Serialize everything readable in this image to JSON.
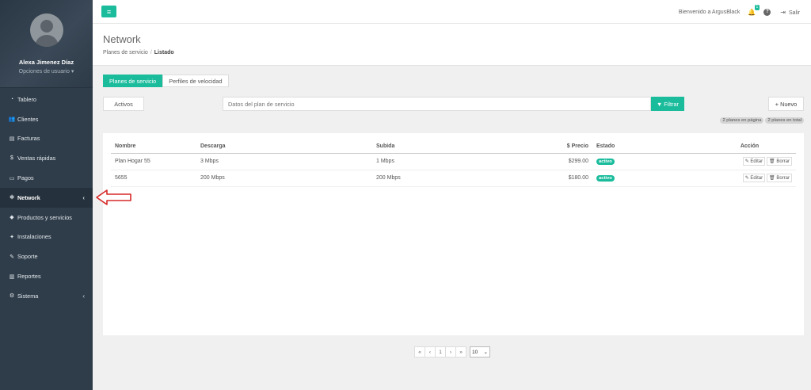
{
  "user": {
    "name": "Alexa Jimenez Díaz",
    "options": "Opciones de usuario"
  },
  "nav": [
    {
      "label": "Tablero",
      "icon": "dashboard-icon",
      "glyph": "◔"
    },
    {
      "label": "Clientes",
      "icon": "users-icon",
      "glyph": "👥"
    },
    {
      "label": "Facturas",
      "icon": "file-icon",
      "glyph": "▤"
    },
    {
      "label": "Ventas rápidas",
      "icon": "dollar-icon",
      "glyph": "$"
    },
    {
      "label": "Pagos",
      "icon": "money-icon",
      "glyph": "▭"
    },
    {
      "label": "Network",
      "icon": "sitemap-icon",
      "glyph": "✲",
      "active": true,
      "chevron": "‹"
    },
    {
      "label": "Productos y servicios",
      "icon": "tag-icon",
      "glyph": "◆"
    },
    {
      "label": "Instalaciones",
      "icon": "wrench-icon",
      "glyph": "✦"
    },
    {
      "label": "Soporte",
      "icon": "tool-icon",
      "glyph": "✎"
    },
    {
      "label": "Reportes",
      "icon": "book-icon",
      "glyph": "▥"
    },
    {
      "label": "Sistema",
      "icon": "cogs-icon",
      "glyph": "⚙",
      "chevron": "‹"
    }
  ],
  "topbar": {
    "welcome": "Bienvenido a ArgusBlack",
    "notifications": "1",
    "help": "?",
    "logout": "Salir"
  },
  "header": {
    "title": "Network",
    "breadcrumb": [
      "Planes de servicio",
      "Listado"
    ]
  },
  "tabs": [
    "Planes de servicio",
    "Perfiles de velocidad"
  ],
  "filter": {
    "status": "Activos",
    "placeholder": "Datos del plan de servicio",
    "filter_btn": "Filtrar",
    "new_btn": "Nuevo"
  },
  "counts": [
    "2 planes en página",
    "2 planes en total"
  ],
  "table": {
    "headers": [
      "Nombre",
      "Descarga",
      "Subida",
      "$ Precio",
      "Estado",
      "Acción"
    ],
    "rows": [
      {
        "nombre": "Plan Hogar 55",
        "descarga": "3 Mbps",
        "subida": "1 Mbps",
        "precio": "$299.00",
        "estado": "activo"
      },
      {
        "nombre": "5655",
        "descarga": "200 Mbps",
        "subida": "200 Mbps",
        "precio": "$180.00",
        "estado": "activo"
      }
    ],
    "edit_label": "Editar",
    "delete_label": "Borrar"
  },
  "pagination": {
    "first": "«",
    "prev": "‹",
    "page": "1",
    "next": "›",
    "last": "»",
    "per_page": "10"
  },
  "colors": {
    "accent": "#1abc9c",
    "sidebar": "#2f3d4a",
    "arrow": "#d62828"
  }
}
